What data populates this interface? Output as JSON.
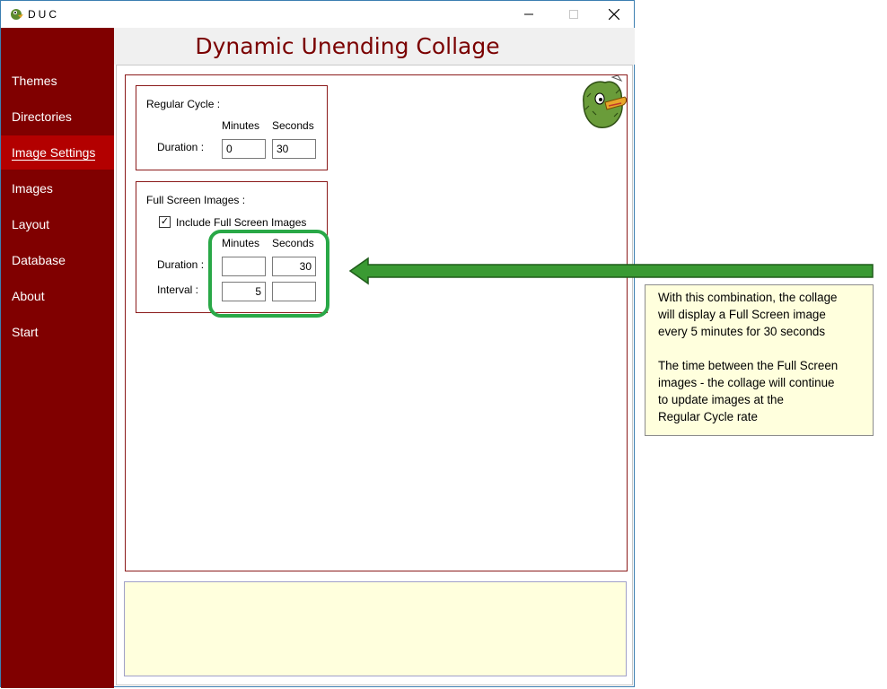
{
  "window": {
    "title": "DUC",
    "app_title": "Dynamic Unending Collage"
  },
  "sidebar": {
    "items": [
      {
        "label": "Themes"
      },
      {
        "label": "Directories"
      },
      {
        "label": "Image Settings",
        "active": true
      },
      {
        "label": "Images"
      },
      {
        "label": "Layout"
      },
      {
        "label": "Database"
      },
      {
        "label": "About"
      },
      {
        "label": "Start"
      }
    ]
  },
  "regular_cycle": {
    "title": "Regular Cycle :",
    "minutes_label": "Minutes",
    "seconds_label": "Seconds",
    "duration_label": "Duration :",
    "duration_minutes": "0",
    "duration_seconds": "30"
  },
  "full_screen": {
    "title": "Full Screen Images :",
    "include_label": "Include Full Screen Images",
    "include_checked": true,
    "minutes_label": "Minutes",
    "seconds_label": "Seconds",
    "duration_label": "Duration :",
    "interval_label": "Interval :",
    "duration_minutes": "",
    "duration_seconds": "30",
    "interval_minutes": "5",
    "interval_seconds": ""
  },
  "annotation": {
    "line1": "With this combination, the collage",
    "line2": "will display a Full Screen image",
    "line3": "every 5 minutes for 30 seconds",
    "line4": "The time between the Full Screen",
    "line5": "images - the collage will continue",
    "line6": "to update images at the",
    "line7": "Regular Cycle rate"
  },
  "colors": {
    "sidebar": "#800000",
    "sidebar_active": "#b30000",
    "title": "#7a0000",
    "highlight": "#29a847",
    "note_bg": "#ffffdd"
  }
}
